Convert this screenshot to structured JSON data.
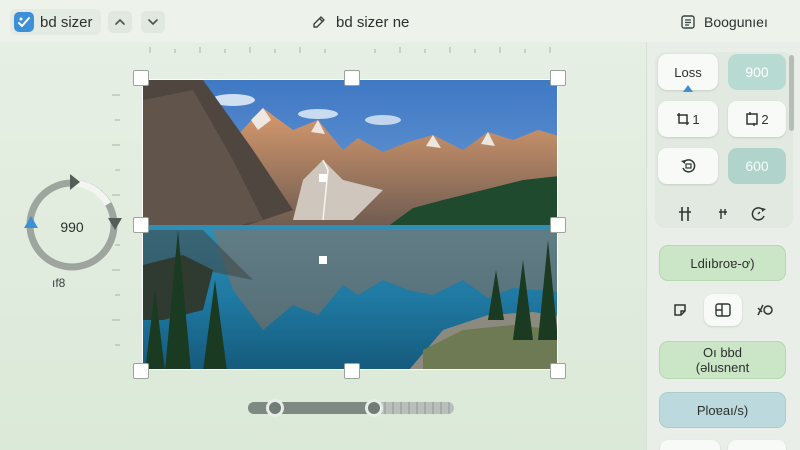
{
  "header": {
    "app_title": "bd sizer",
    "doc_title": "bd sizer ne",
    "right_title": "Boogunıeı",
    "icons": {
      "app_logo": "image-sizer-logo-icon",
      "nav_up": "chevron-up-icon",
      "nav_down": "chevron-down-icon",
      "doc": "edit-pen-icon",
      "right": "document-icon"
    }
  },
  "editor": {
    "image_subject": "mountain lake with pine trees",
    "rotation": {
      "value": "990",
      "label": "ıf8"
    },
    "slider": {
      "low_fraction": 0.13,
      "high_fraction": 0.61
    }
  },
  "panel": {
    "loss_label": "Loss",
    "value_top": "900",
    "crop_a_label": "1",
    "crop_b_label": "2",
    "value_mid": "600",
    "action_wide_1": "Ldiıbroɐ-ơ)",
    "action_wide_2_line1": "Oı bbd",
    "action_wide_2_line2": "(ǝlusnent",
    "action_wide_3": "Ploɐaı/s)",
    "icons": [
      "frame-1-icon",
      "frame-2-icon",
      "rotate-left-icon",
      "flip-vertical-icon",
      "flip-small-icon",
      "rotate-right-icon",
      "edit-frame-icon",
      "split-icon",
      "ratio-icon"
    ]
  },
  "colors": {
    "accent_blue": "#3d8fd6",
    "teal_button": "#b7dbd2",
    "green_button": "#cbe5c7",
    "blue_button": "#bcd9dd"
  }
}
